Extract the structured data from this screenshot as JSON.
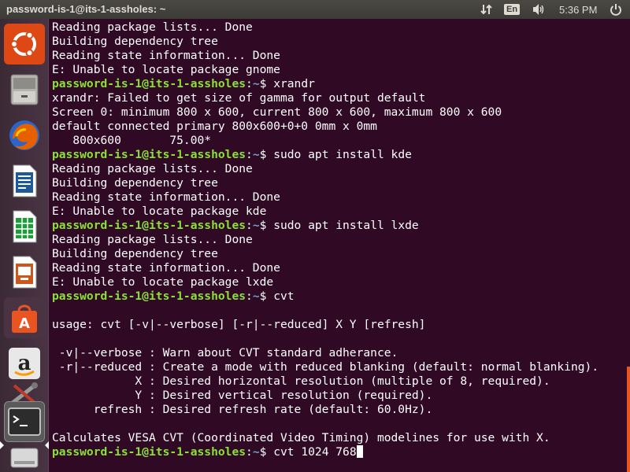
{
  "topbar": {
    "title": "password-is-1@its-1-assholes: ~",
    "language": "En",
    "time": "5:36 PM"
  },
  "launcher": {
    "items": [
      {
        "name": "dash-home",
        "icon": "ubuntu-logo-icon",
        "color": "#dd4814"
      },
      {
        "name": "files",
        "icon": "file-cabinet-icon",
        "color": "#9a9a96"
      },
      {
        "name": "firefox",
        "icon": "firefox-icon",
        "color": "#e66000"
      },
      {
        "name": "libreoffice-writer",
        "icon": "writer-document-icon",
        "color": "#1e5a9b"
      },
      {
        "name": "libreoffice-calc",
        "icon": "calc-spreadsheet-icon",
        "color": "#1f9a3c"
      },
      {
        "name": "libreoffice-impress",
        "icon": "impress-presentation-icon",
        "color": "#c9571e"
      },
      {
        "name": "software-center",
        "icon": "shopping-bag-icon",
        "color": "#e95420"
      },
      {
        "name": "amazon",
        "icon": "amazon-icon",
        "color": "#d9d9d9"
      },
      {
        "name": "system-settings",
        "icon": "settings-tools-icon",
        "color": "#888888"
      },
      {
        "name": "terminal",
        "icon": "terminal-icon",
        "color": "#2c2c2c",
        "active": true
      },
      {
        "name": "removable-drive",
        "icon": "drive-icon",
        "color": "#cccccc"
      }
    ]
  },
  "terminal": {
    "prompt_user": "password-is-1@its-1-assholes",
    "prompt_path": "~",
    "lines": [
      {
        "type": "out",
        "text": "Reading package lists... Done"
      },
      {
        "type": "out",
        "text": "Building dependency tree"
      },
      {
        "type": "out",
        "text": "Reading state information... Done"
      },
      {
        "type": "out",
        "text": "E: Unable to locate package gnome"
      },
      {
        "type": "cmd",
        "text": "xrandr"
      },
      {
        "type": "out",
        "text": "xrandr: Failed to get size of gamma for output default"
      },
      {
        "type": "out",
        "text": "Screen 0: minimum 800 x 600, current 800 x 600, maximum 800 x 600"
      },
      {
        "type": "out",
        "text": "default connected primary 800x600+0+0 0mm x 0mm"
      },
      {
        "type": "out",
        "text": "   800x600       75.00*"
      },
      {
        "type": "cmd",
        "text": "sudo apt install kde"
      },
      {
        "type": "out",
        "text": "Reading package lists... Done"
      },
      {
        "type": "out",
        "text": "Building dependency tree"
      },
      {
        "type": "out",
        "text": "Reading state information... Done"
      },
      {
        "type": "out",
        "text": "E: Unable to locate package kde"
      },
      {
        "type": "cmd",
        "text": "sudo apt install lxde"
      },
      {
        "type": "out",
        "text": "Reading package lists... Done"
      },
      {
        "type": "out",
        "text": "Building dependency tree"
      },
      {
        "type": "out",
        "text": "Reading state information... Done"
      },
      {
        "type": "out",
        "text": "E: Unable to locate package lxde"
      },
      {
        "type": "cmd",
        "text": "cvt"
      },
      {
        "type": "out",
        "text": ""
      },
      {
        "type": "out",
        "text": "usage: cvt [-v|--verbose] [-r|--reduced] X Y [refresh]"
      },
      {
        "type": "out",
        "text": ""
      },
      {
        "type": "out",
        "text": " -v|--verbose : Warn about CVT standard adherance."
      },
      {
        "type": "out",
        "text": " -r|--reduced : Create a mode with reduced blanking (default: normal blanking)."
      },
      {
        "type": "out",
        "text": "            X : Desired horizontal resolution (multiple of 8, required)."
      },
      {
        "type": "out",
        "text": "            Y : Desired vertical resolution (required)."
      },
      {
        "type": "out",
        "text": "      refresh : Desired refresh rate (default: 60.0Hz)."
      },
      {
        "type": "out",
        "text": ""
      },
      {
        "type": "out",
        "text": "Calculates VESA CVT (Coordinated Video Timing) modelines for use with X."
      },
      {
        "type": "current",
        "text": "cvt 1024 768"
      }
    ]
  }
}
